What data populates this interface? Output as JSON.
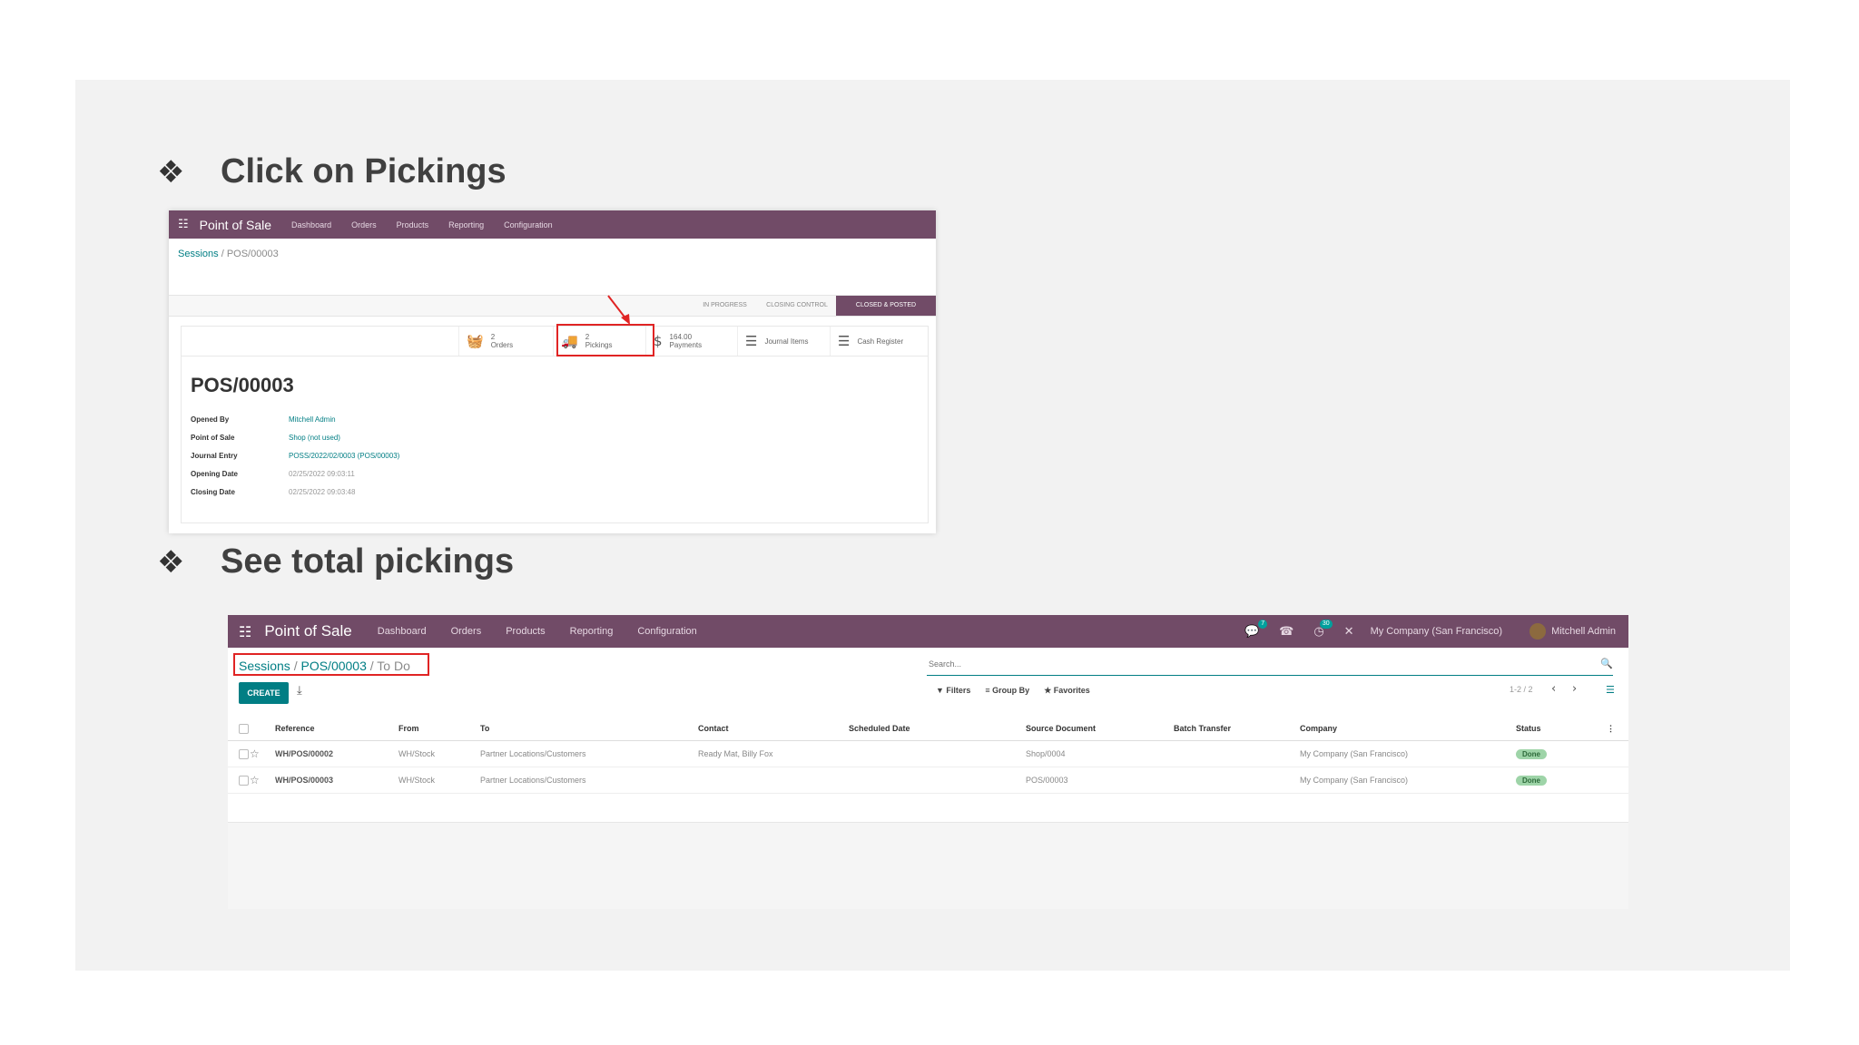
{
  "steps": [
    {
      "symbol": "❖",
      "text": "Click on Pickings"
    },
    {
      "symbol": "❖",
      "text": "See total pickings"
    }
  ],
  "shot1": {
    "app_title": "Point of Sale",
    "menu": [
      "Dashboard",
      "Orders",
      "Products",
      "Reporting",
      "Configuration"
    ],
    "breadcrumb_parent": "Sessions",
    "breadcrumb_sep": " / ",
    "breadcrumb_current": "POS/00003",
    "stages": [
      "IN PROGRESS",
      "CLOSING CONTROL",
      "CLOSED & POSTED"
    ],
    "smart_buttons": [
      {
        "icon": "shopping-basket-icon",
        "glyph": "🧺",
        "line1": "2",
        "line2": "Orders"
      },
      {
        "icon": "truck-icon",
        "glyph": "🚚",
        "line1": "2",
        "line2": "Pickings"
      },
      {
        "icon": "dollar-icon",
        "glyph": "$",
        "line1": "164.00",
        "line2": "Payments"
      },
      {
        "icon": "list-icon",
        "glyph": "☰",
        "line1": "Journal Items",
        "line2": ""
      },
      {
        "icon": "list-icon",
        "glyph": "☰",
        "line1": "Cash Register",
        "line2": ""
      }
    ],
    "record_name": "POS/00003",
    "fields": [
      {
        "label": "Opened By",
        "value": "Mitchell Admin",
        "link": true
      },
      {
        "label": "Point of Sale",
        "value": "Shop (not used)",
        "link": true
      },
      {
        "label": "Journal Entry",
        "value": "POSS/2022/02/0003 (POS/00003)",
        "link": true
      },
      {
        "label": "Opening Date",
        "value": "02/25/2022 09:03:11",
        "link": false
      },
      {
        "label": "Closing Date",
        "value": "02/25/2022 09:03:48",
        "link": false
      }
    ],
    "highlight_color": "#e02424"
  },
  "shot2": {
    "app_title": "Point of Sale",
    "menu": [
      "Dashboard",
      "Orders",
      "Products",
      "Reporting",
      "Configuration"
    ],
    "nav_right": {
      "chat_badge": "7",
      "activity_badge": "30",
      "company": "My Company (San Francisco)",
      "user": "Mitchell Admin"
    },
    "breadcrumb": [
      "Sessions",
      "POS/00003",
      "To Do"
    ],
    "breadcrumb_sep": " / ",
    "search_placeholder": "Search...",
    "create_label": "CREATE",
    "filters": [
      "▼ Filters",
      "≡ Group By",
      "★ Favorites"
    ],
    "pager": "1-2 / 2",
    "columns": [
      "Reference",
      "From",
      "To",
      "Contact",
      "Scheduled Date",
      "Source Document",
      "Batch Transfer",
      "Company",
      "Status"
    ],
    "rows": [
      {
        "reference": "WH/POS/00002",
        "from": "WH/Stock",
        "to": "Partner Locations/Customers",
        "contact": "Ready Mat, Billy Fox",
        "scheduled": "",
        "source": "Shop/0004",
        "batch": "",
        "company": "My Company (San Francisco)",
        "status": "Done"
      },
      {
        "reference": "WH/POS/00003",
        "from": "WH/Stock",
        "to": "Partner Locations/Customers",
        "contact": "",
        "scheduled": "",
        "source": "POS/00003",
        "batch": "",
        "company": "My Company (San Francisco)",
        "status": "Done"
      }
    ],
    "brand_color": "#714b67",
    "accent_color": "#017e84"
  }
}
